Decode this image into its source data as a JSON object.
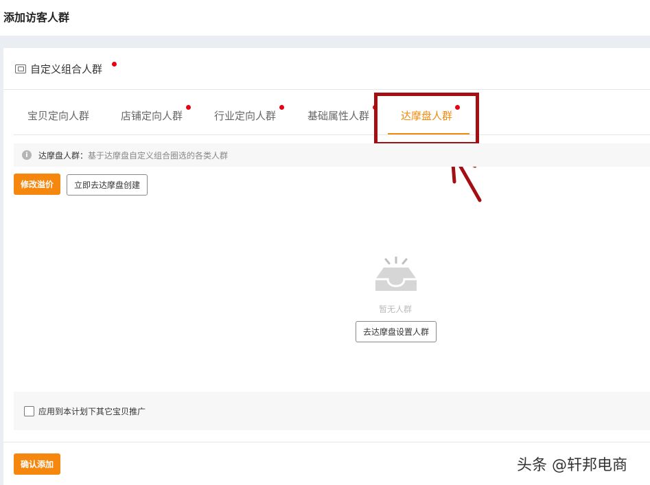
{
  "page": {
    "title": "添加访客人群"
  },
  "card": {
    "title": "自定义组合人群"
  },
  "tabs": [
    {
      "label": "宝贝定向人群"
    },
    {
      "label": "店铺定向人群"
    },
    {
      "label": "行业定向人群"
    },
    {
      "label": "基础属性人群"
    },
    {
      "label": "达摩盘人群"
    }
  ],
  "info": {
    "label": "达摩盘人群：",
    "description": "基于达摩盘自定义组合圈选的各类人群"
  },
  "actions": {
    "modify_premium": "修改溢价",
    "create_now": "立即去达摩盘创建"
  },
  "empty_state": {
    "text": "暂无人群",
    "button": "去达摩盘设置人群"
  },
  "apply": {
    "label": "应用到本计划下其它宝贝推广"
  },
  "footer": {
    "confirm": "确认添加"
  },
  "watermark": "头条 @轩邦电商",
  "colors": {
    "accent": "#f08a0c",
    "button_orange": "#f5870f",
    "dot_red": "#e60012",
    "annotation": "#a30f12"
  }
}
